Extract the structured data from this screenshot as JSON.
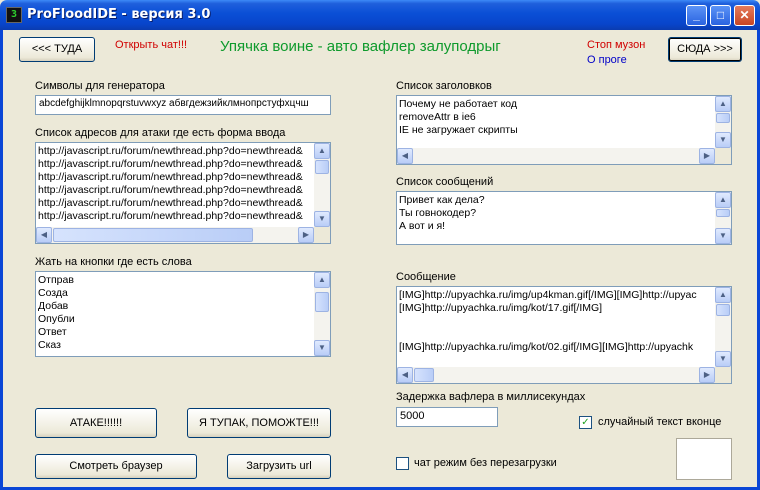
{
  "window": {
    "title": "ProFloodIDE - версия 3.0",
    "icon_glyph": "3",
    "minimize_glyph": "_",
    "maximize_glyph": "□",
    "close_glyph": "✕"
  },
  "header": {
    "back_button": "<<< ТУДА",
    "open_chat": "Открыть чат!!!",
    "banner": "Упячка воине - авто вафлер залуподрыг",
    "stop_music": "Стоп музон",
    "about": "О проге",
    "forward_button": "СЮДА >>>"
  },
  "generator": {
    "label": "Символы для генератора",
    "value": "abcdefghijklmnopqrstuvwxyz абвгдежзийклмнопрстуфхцчш"
  },
  "addresses": {
    "label": "Список адресов для атаки где есть форма ввода",
    "items": [
      "http://javascript.ru/forum/newthread.php?do=newthread&",
      "http://javascript.ru/forum/newthread.php?do=newthread&",
      "http://javascript.ru/forum/newthread.php?do=newthread&",
      "http://javascript.ru/forum/newthread.php?do=newthread&",
      "http://javascript.ru/forum/newthread.php?do=newthread&",
      "http://javascript.ru/forum/newthread.php?do=newthread&"
    ]
  },
  "buttons_words": {
    "label": "Жать на кнопки где есть слова",
    "items": [
      "Отправ",
      "Созда",
      "Добав",
      "Опубли",
      "Ответ",
      "Сказ"
    ]
  },
  "headings": {
    "label": "Список заголовков",
    "items": [
      "Почему не работает код",
      "removeAttr в ie6",
      "IE не загружает скрипты"
    ]
  },
  "messages": {
    "label": "Список сообщений",
    "items": [
      "Привет как дела?",
      "Ты говнокодер?",
      "А вот и я!"
    ]
  },
  "message": {
    "label": "Сообщение",
    "lines": [
      "[IMG]http://upyachka.ru/img/up4kman.gif[/IMG][IMG]http://upyac",
      "[IMG]http://upyachka.ru/img/kot/17.gif[/IMG]",
      "",
      "",
      "[IMG]http://upyachka.ru/img/kot/02.gif[/IMG][IMG]http://upyachk"
    ]
  },
  "delay": {
    "label": "Задержка вафлера в миллисекундах",
    "value": "5000"
  },
  "options": {
    "random_text": "случайный текст вконце",
    "random_text_checked": true,
    "chat_mode": "чат режим без перезагрузки",
    "chat_mode_checked": false
  },
  "actions": {
    "attack": "АТАКЕ!!!!!!",
    "help": "Я ТУПАК, ПОМОЖТЕ!!!",
    "browser": "Смотреть браузер",
    "load_url": "Загрузить url"
  },
  "scroll_glyphs": {
    "up": "▲",
    "down": "▼",
    "left": "◀",
    "right": "▶",
    "check": "✓"
  },
  "colors": {
    "banner_green": "#0e9a2c",
    "link_red": "#d00000",
    "link_blue": "#0000c8",
    "titlebar_blue": "#0a4fd6"
  }
}
